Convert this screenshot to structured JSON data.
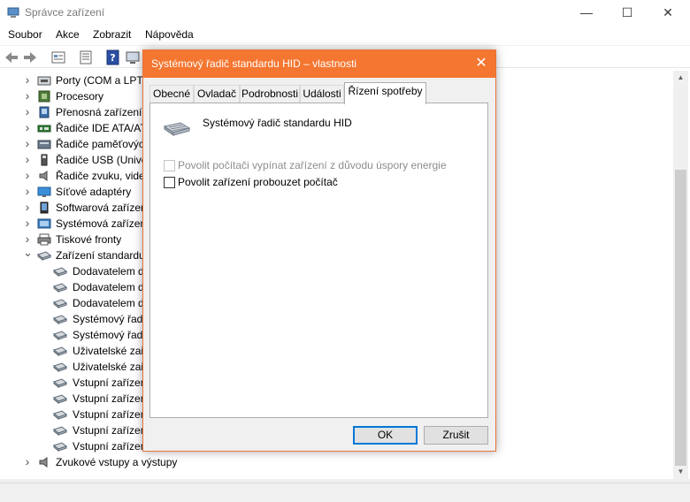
{
  "window": {
    "title": "Správce zařízení",
    "controls": {
      "minimize": "—",
      "maximize": "☐",
      "close": "✕"
    }
  },
  "menu": [
    "Soubor",
    "Akce",
    "Zobrazit",
    "Nápověda"
  ],
  "tree": [
    {
      "label": "Porty (COM a LPT)",
      "icon": "port-icon",
      "expanded": false
    },
    {
      "label": "Procesory",
      "icon": "processor-icon",
      "expanded": false
    },
    {
      "label": "Přenosná zařízení",
      "icon": "portable-device-icon",
      "expanded": false
    },
    {
      "label": "Řadiče IDE ATA/ATAPI",
      "icon": "ide-controller-icon",
      "expanded": false
    },
    {
      "label": "Řadiče paměťových",
      "icon": "storage-controller-icon",
      "expanded": false
    },
    {
      "label": "Řadiče USB (Univer",
      "icon": "usb-controller-icon",
      "expanded": false
    },
    {
      "label": "Řadiče zvuku, vide",
      "icon": "sound-controller-icon",
      "expanded": false
    },
    {
      "label": "Síťové adaptéry",
      "icon": "network-adapter-icon",
      "expanded": false
    },
    {
      "label": "Softwarová zařízen",
      "icon": "software-device-icon",
      "expanded": false
    },
    {
      "label": "Systémová zařízen",
      "icon": "system-device-icon",
      "expanded": false
    },
    {
      "label": "Tiskové fronty",
      "icon": "printer-icon",
      "expanded": false
    },
    {
      "label": "Zařízení standardu",
      "icon": "hid-icon",
      "expanded": true
    },
    {
      "label": "Dodavatelem d",
      "icon": "hid-icon",
      "child": true
    },
    {
      "label": "Dodavatelem d",
      "icon": "hid-icon",
      "child": true
    },
    {
      "label": "Dodavatelem d",
      "icon": "hid-icon",
      "child": true
    },
    {
      "label": "Systémový řadi",
      "icon": "hid-icon",
      "child": true
    },
    {
      "label": "Systémový řadi",
      "icon": "hid-icon",
      "child": true
    },
    {
      "label": "Uživatelské zař",
      "icon": "hid-icon",
      "child": true
    },
    {
      "label": "Uživatelské zař",
      "icon": "hid-icon",
      "child": true
    },
    {
      "label": "Vstupní zařízen",
      "icon": "hid-icon",
      "child": true
    },
    {
      "label": "Vstupní zařízen",
      "icon": "hid-icon",
      "child": true
    },
    {
      "label": "Vstupní zařízen",
      "icon": "hid-icon",
      "child": true
    },
    {
      "label": "Vstupní zařízen",
      "icon": "hid-icon",
      "child": true
    },
    {
      "label": "Vstupní zařízen",
      "icon": "hid-icon",
      "child": true
    },
    {
      "label": "Zvukové vstupy a výstupy",
      "icon": "speaker-icon",
      "expanded": false
    }
  ],
  "dialog": {
    "title": "Systémový řadič standardu HID – vlastnosti",
    "close": "✕",
    "tabs": [
      "Obecné",
      "Ovladač",
      "Podrobnosti",
      "Události",
      "Řízení spotřeby"
    ],
    "active_tab": 4,
    "device_name": "Systémový řadič standardu HID",
    "options": [
      {
        "label": "Povolit počítači vypínat zařízení z důvodu úspory energie",
        "checked": false,
        "disabled": true
      },
      {
        "label": "Povolit zařízení probouzet počítač",
        "checked": false,
        "disabled": false
      }
    ],
    "ok_label": "OK",
    "cancel_label": "Zrušit"
  },
  "colors": {
    "dialog_title": "#f47630",
    "focus_border": "#0078d7"
  }
}
